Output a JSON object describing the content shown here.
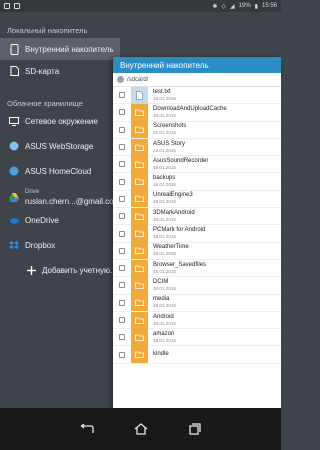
{
  "status_bar": {
    "battery": "19%",
    "time": "15:56"
  },
  "drawer": {
    "local_section": "Локальный накопитель",
    "cloud_section": "Облачное хранилище",
    "items": [
      {
        "label": "Внутренний накопитель",
        "icon": "phone-icon"
      },
      {
        "label": "SD-карта",
        "icon": "sd-card-icon"
      },
      {
        "label": "Сетевое окружение",
        "icon": "network-icon"
      },
      {
        "label": "ASUS WebStorage",
        "icon": "webstorage-icon"
      },
      {
        "label": "ASUS HomeCloud",
        "icon": "homecloud-icon"
      },
      {
        "label": "Drive",
        "sub": "ruslan.chern...@gmail.com",
        "icon": "drive-icon"
      },
      {
        "label": "OneDrive",
        "icon": "onedrive-icon"
      },
      {
        "label": "Dropbox",
        "icon": "dropbox-icon"
      },
      {
        "label": "Добавить учетную...",
        "icon": "plus-icon"
      }
    ]
  },
  "panel": {
    "title": "Внутренний накопитель",
    "path": "/sdcard/",
    "files": [
      {
        "name": "test.txt",
        "date": "18.01.2015",
        "type": "doc"
      },
      {
        "name": "DownloadAndUploadCache",
        "date": "18.01.2015",
        "type": "folder"
      },
      {
        "name": "Screenshots",
        "date": "22.01.2015",
        "type": "folder"
      },
      {
        "name": "ASUS Story",
        "date": "22.01.2015",
        "type": "folder"
      },
      {
        "name": "AsusSoundRecorder",
        "date": "18.01.2015",
        "type": "folder"
      },
      {
        "name": "backups",
        "date": "18.01.2015",
        "type": "folder"
      },
      {
        "name": "UnrealEngine3",
        "date": "18.01.2015",
        "type": "folder"
      },
      {
        "name": "3DMarkAndroid",
        "date": "18.01.2015",
        "type": "folder"
      },
      {
        "name": "PCMark for Android",
        "date": "18.01.2015",
        "type": "folder"
      },
      {
        "name": "WeatherTime",
        "date": "18.01.2015",
        "type": "folder"
      },
      {
        "name": "Browser_Savedfiles",
        "date": "18.01.2015",
        "type": "folder"
      },
      {
        "name": "DCIM",
        "date": "18.01.2015",
        "type": "folder"
      },
      {
        "name": "media",
        "date": "18.01.2015",
        "type": "folder"
      },
      {
        "name": "Android",
        "date": "18.01.2015",
        "type": "folder"
      },
      {
        "name": "amazon",
        "date": "18.01.2015",
        "type": "folder"
      },
      {
        "name": "kindle",
        "date": "",
        "type": "folder"
      }
    ]
  },
  "colors": {
    "drawer_bg": "#3e4449",
    "active_item": "#5b6167",
    "panel_header": "#2b8ec2",
    "folder": "#f2a93b",
    "nav_bar": "#181818"
  }
}
